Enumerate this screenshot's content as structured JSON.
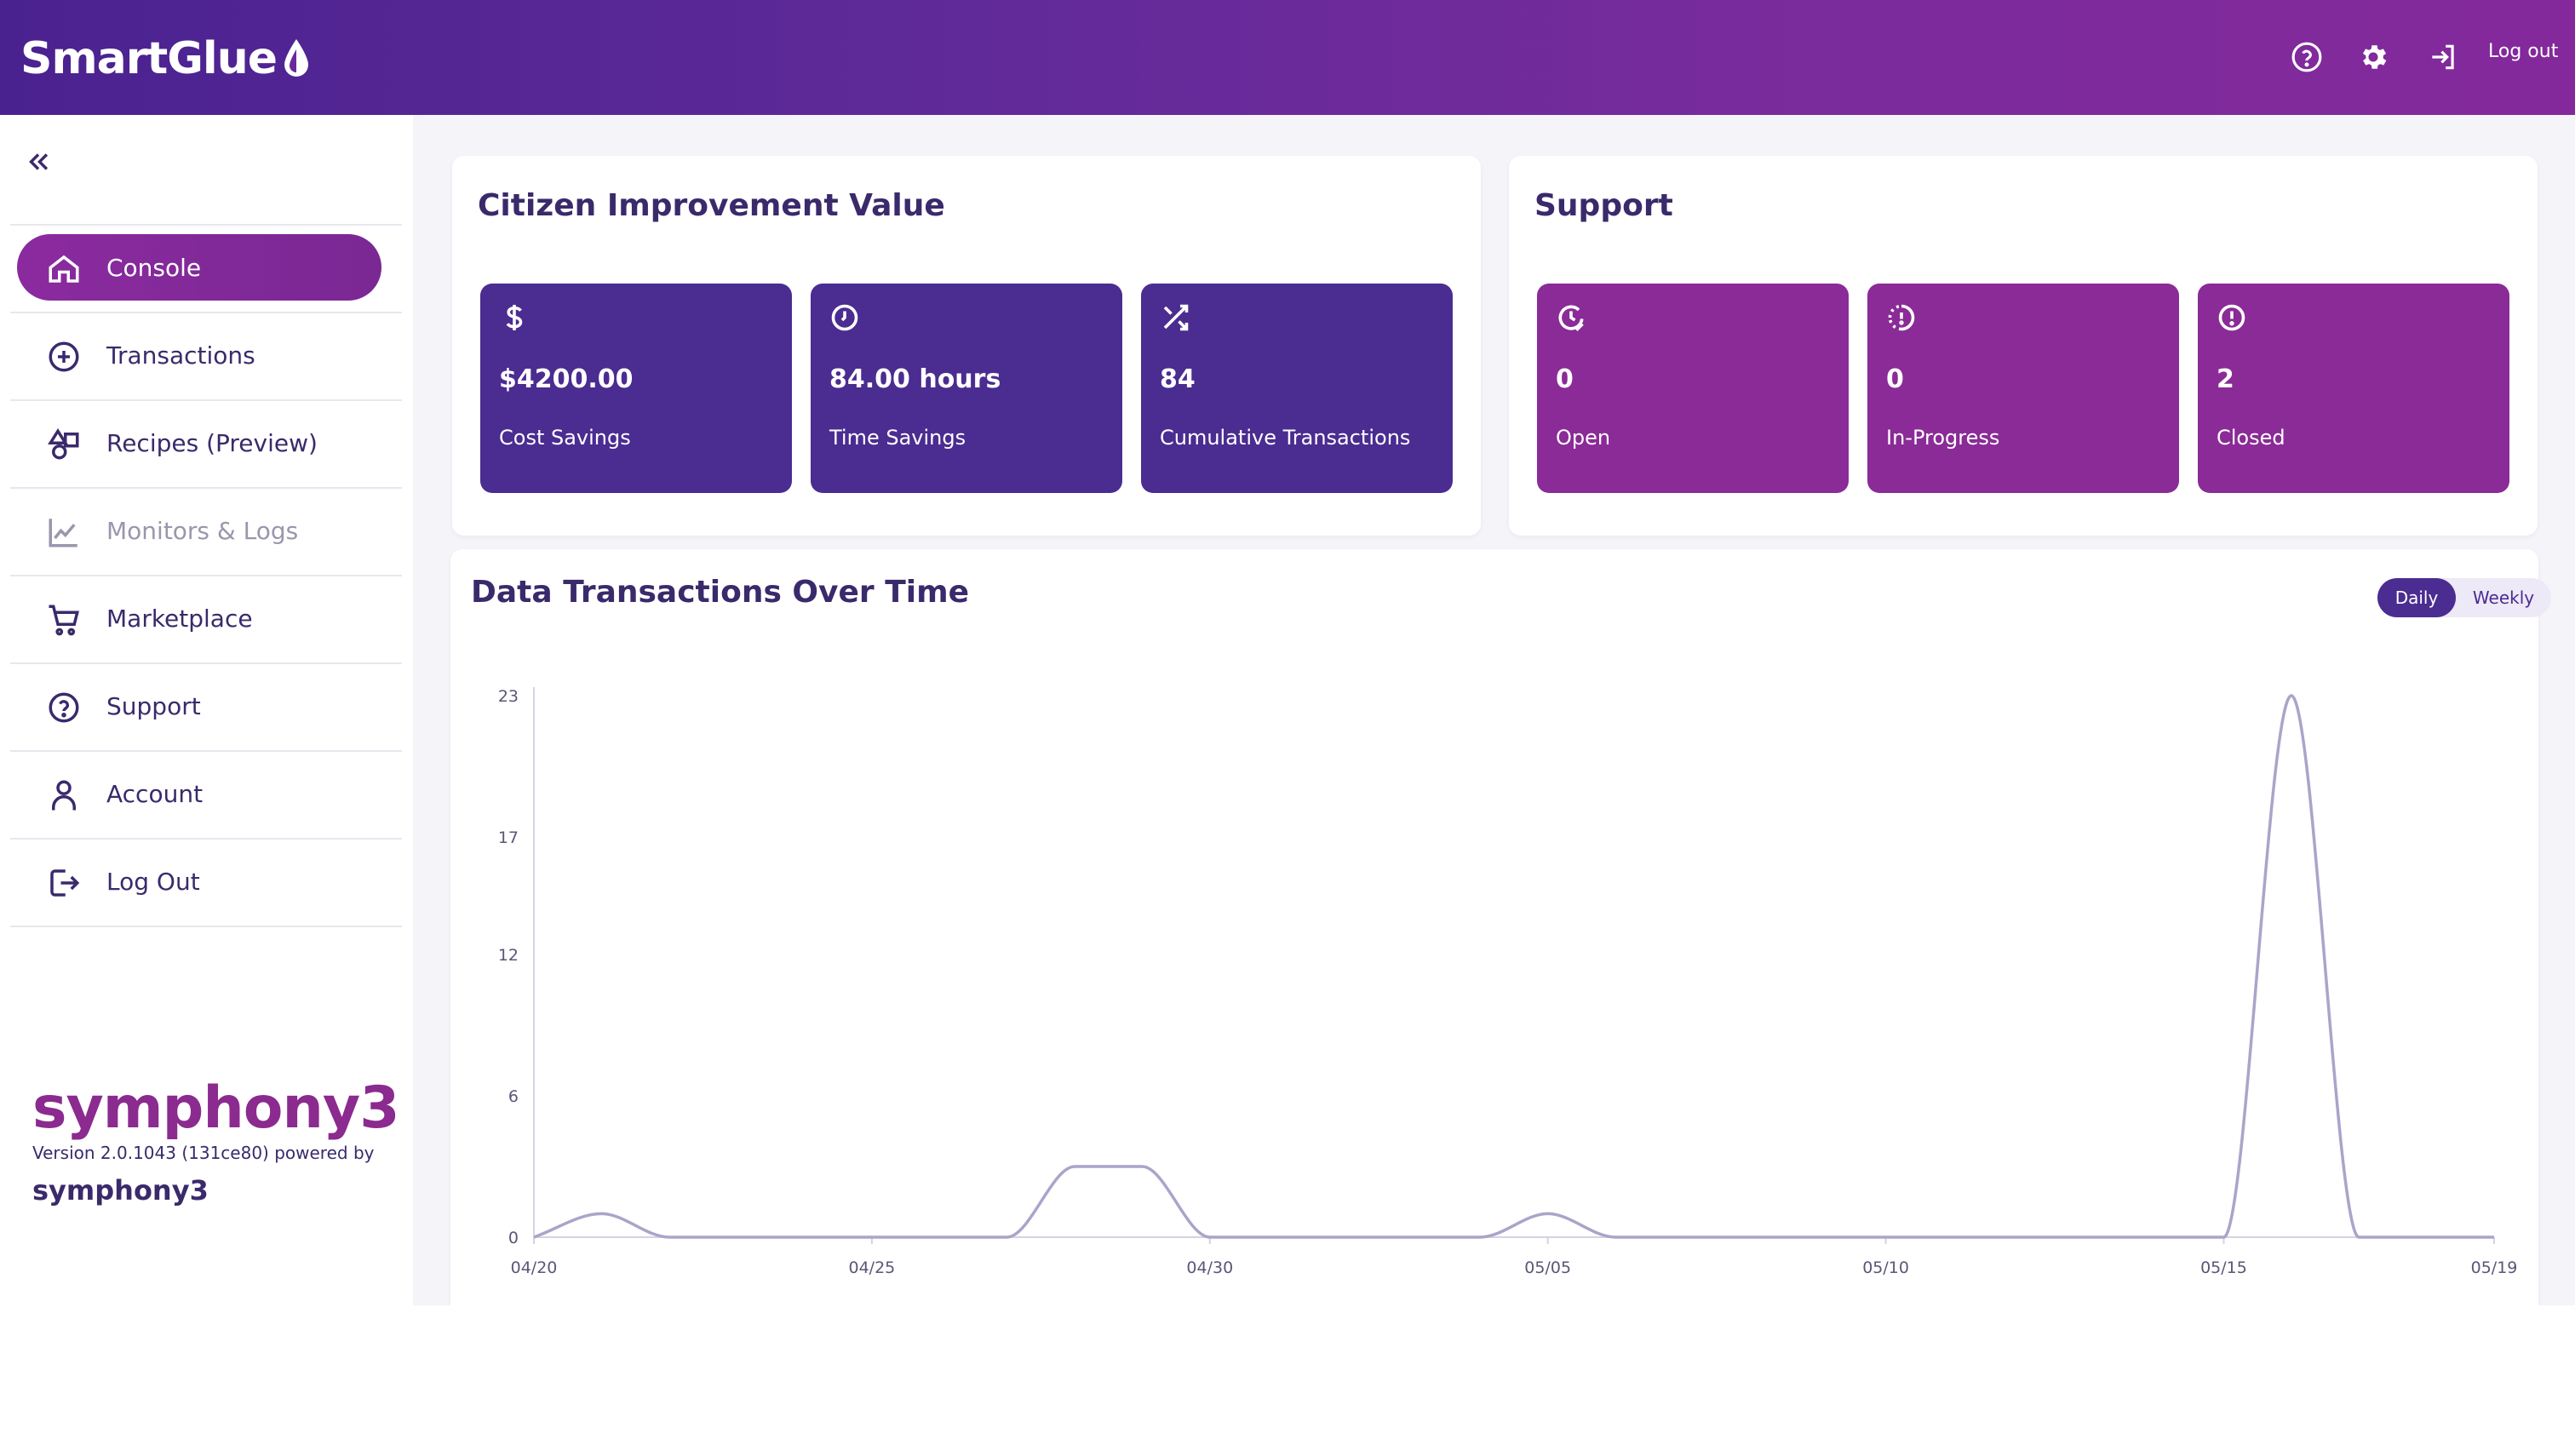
{
  "header": {
    "brand": "SmartGlue",
    "logout_label": "Log out",
    "icons": [
      "help-icon",
      "settings-icon",
      "logout-icon"
    ]
  },
  "sidebar": {
    "items": [
      {
        "label": "Console",
        "icon": "home-icon",
        "active": true
      },
      {
        "label": "Transactions",
        "icon": "plus-circle-icon"
      },
      {
        "label": "Recipes (Preview)",
        "icon": "shapes-icon"
      },
      {
        "label": "Monitors & Logs",
        "icon": "chart-line-icon",
        "disabled": true
      },
      {
        "label": "Marketplace",
        "icon": "cart-icon"
      },
      {
        "label": "Support",
        "icon": "help-icon"
      },
      {
        "label": "Account",
        "icon": "user-icon"
      },
      {
        "label": "Log Out",
        "icon": "logout-icon"
      }
    ],
    "footer": {
      "logo": "symphony3",
      "version": "Version 2.0.1043 (131ce80) powered by",
      "powered_by": "symphony3"
    }
  },
  "value_card": {
    "title": "Citizen Improvement Value",
    "tiles": [
      {
        "icon": "dollar-icon",
        "value": "$4200.00",
        "label": "Cost Savings"
      },
      {
        "icon": "clock-icon",
        "value": "84.00 hours",
        "label": "Time Savings"
      },
      {
        "icon": "shuffle-icon",
        "value": "84",
        "label": "Cumulative Transactions"
      }
    ]
  },
  "support_card": {
    "title": "Support",
    "tiles": [
      {
        "icon": "clock-check-icon",
        "value": "0",
        "label": "Open"
      },
      {
        "icon": "progress-icon",
        "value": "0",
        "label": "In-Progress"
      },
      {
        "icon": "alert-circle-icon",
        "value": "2",
        "label": "Closed"
      }
    ]
  },
  "chart_card": {
    "title": "Data Transactions Over Time",
    "toggle": {
      "daily": "Daily",
      "weekly": "Weekly",
      "selected": "Daily"
    }
  },
  "colors": {
    "header_start": "#4a2290",
    "header_end": "#84299c",
    "value_tile": "#4b2c91",
    "support_tile": "#8a2b97",
    "line": "#a9a5c9"
  },
  "chart_data": {
    "type": "line",
    "title": "Data Transactions Over Time",
    "xlabel": "",
    "ylabel": "",
    "x_ticks": [
      "04/20",
      "04/25",
      "04/30",
      "05/05",
      "05/10",
      "05/15",
      "05/19"
    ],
    "y_ticks": [
      0,
      6,
      12,
      17,
      23
    ],
    "ylim": [
      0,
      23
    ],
    "grid": false,
    "series": [
      {
        "x": [
          "04/20",
          "04/21",
          "04/22",
          "04/23",
          "04/24",
          "04/25",
          "04/26",
          "04/27",
          "04/28",
          "04/29",
          "04/30",
          "05/01",
          "05/02",
          "05/03",
          "05/04",
          "05/05",
          "05/06",
          "05/07",
          "05/08",
          "05/09",
          "05/10",
          "05/11",
          "05/12",
          "05/13",
          "05/14",
          "05/15",
          "05/16",
          "05/17",
          "05/18",
          "05/19"
        ],
        "values": [
          0,
          1,
          0,
          0,
          0,
          0,
          0,
          0,
          3,
          3,
          0,
          0,
          0,
          0,
          0,
          1,
          0,
          0,
          0,
          0,
          0,
          0,
          0,
          0,
          0,
          0,
          23,
          0,
          0,
          0
        ]
      }
    ]
  }
}
